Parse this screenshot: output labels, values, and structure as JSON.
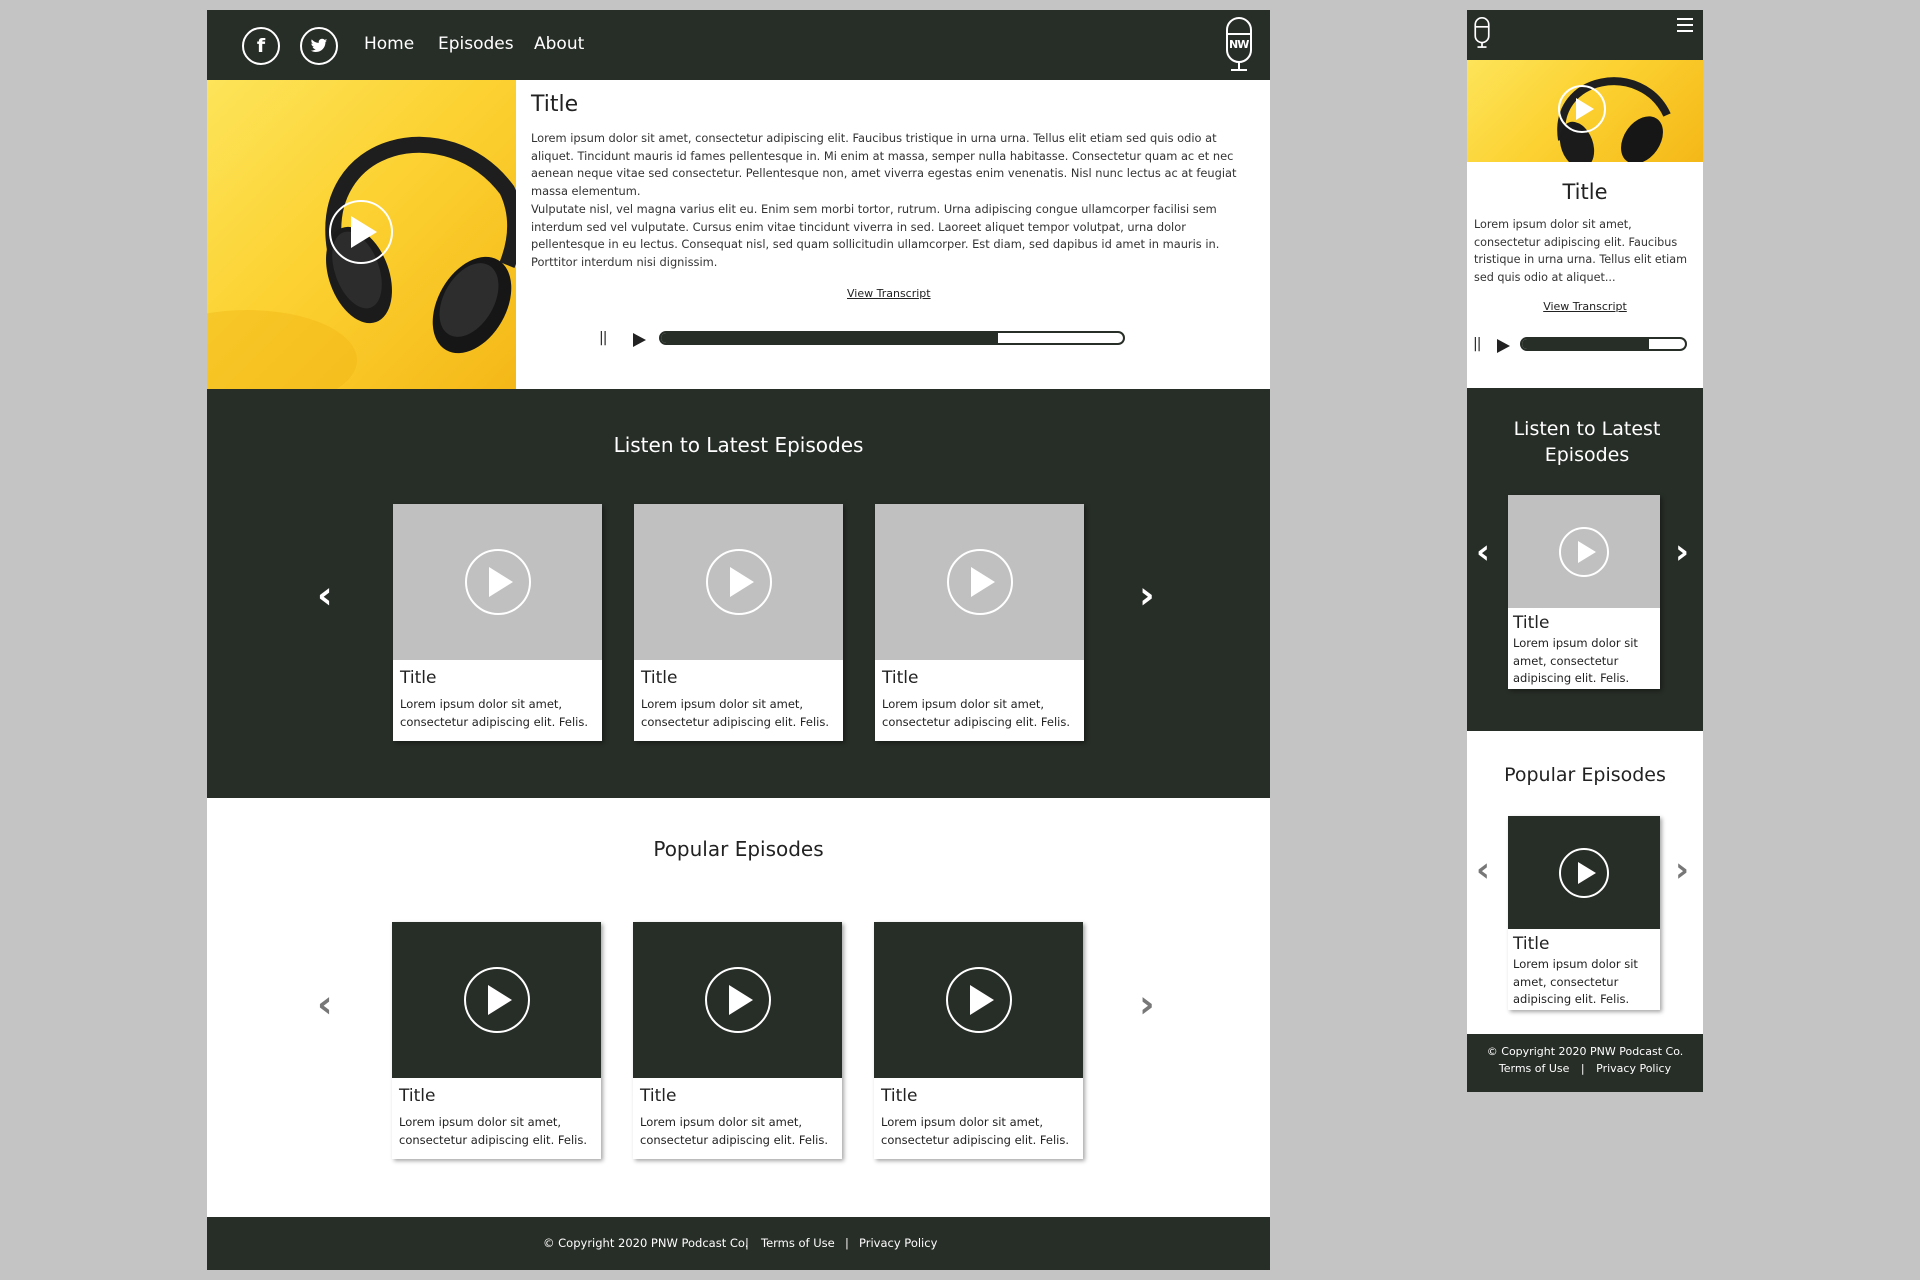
{
  "desktop": {
    "nav": {
      "social": [
        {
          "icon": "facebook-icon",
          "glyph": "f"
        },
        {
          "icon": "twitter-icon",
          "glyph": "t"
        }
      ],
      "links": [
        "Home",
        "Episodes",
        "About"
      ],
      "logo_text": "NW"
    },
    "hero": {
      "title": "Title",
      "paragraph1": "Lorem ipsum dolor sit amet, consectetur adipiscing elit. Faucibus tristique in urna urna. Tellus elit etiam sed quis odio at aliquet. Tincidunt mauris id fames pellentesque in. Mi enim at massa, semper nulla habitasse. Consectetur quam ac et nec aenean neque vitae sed consectetur. Pellentesque non, amet viverra egestas enim venenatis. Nisl nunc lectus ac at feugiat massa elementum.",
      "paragraph2": "Vulputate nisl, vel magna varius elit eu. Enim sem morbi tortor, rutrum. Urna adipiscing congue ullamcorper facilisi sem interdum sed vel vulputate. Cursus enim vitae tincidunt viverra in sed. Laoreet aliquet tempor volutpat, urna dolor pellentesque in eu lectus. Consequat nisl, sed quam sollicitudin ullamcorper. Est diam, sed dapibus id amet in mauris in. Porttitor interdum nisi dignissim.",
      "transcript_link": "View Transcript",
      "pause_glyph": "||",
      "progress": 0.73
    },
    "latest": {
      "heading": "Listen to Latest Episodes",
      "cards": [
        {
          "title": "Title",
          "text": "Lorem ipsum dolor sit amet, consectetur adipiscing elit. Felis."
        },
        {
          "title": "Title",
          "text": "Lorem ipsum dolor sit amet, consectetur adipiscing elit. Felis."
        },
        {
          "title": "Title",
          "text": "Lorem ipsum dolor sit amet, consectetur adipiscing elit. Felis."
        }
      ],
      "prev": "‹",
      "next": "›"
    },
    "popular": {
      "heading": "Popular Episodes",
      "cards": [
        {
          "title": "Title",
          "text": "Lorem ipsum dolor sit amet, consectetur adipiscing elit. Felis."
        },
        {
          "title": "Title",
          "text": "Lorem ipsum dolor sit amet, consectetur adipiscing elit. Felis."
        },
        {
          "title": "Title",
          "text": "Lorem ipsum dolor sit amet, consectetur adipiscing elit. Felis."
        }
      ],
      "prev": "‹",
      "next": "›"
    },
    "footer": {
      "copyright": "© Copyright 2020 PNW Podcast Co.",
      "sep": "|",
      "terms": "Terms of Use",
      "privacy": "Privacy Policy"
    }
  },
  "mobile": {
    "nav": {
      "logo_text": "NW",
      "menu_glyph": "≡"
    },
    "hero": {
      "title": "Title",
      "paragraph": "Lorem ipsum dolor sit amet, consectetur adipiscing elit. Faucibus tristique in urna urna. Tellus elit etiam sed quis odio at aliquet...",
      "transcript_link": "View Transcript",
      "pause_glyph": "||",
      "progress": 0.78
    },
    "latest": {
      "heading": "Listen to Latest Episodes",
      "card": {
        "title": "Title",
        "text": "Lorem ipsum dolor sit amet, consectetur adipiscing elit. Felis."
      },
      "prev": "‹",
      "next": "›"
    },
    "popular": {
      "heading": "Popular Episodes",
      "card": {
        "title": "Title",
        "text": "Lorem ipsum dolor sit amet, consectetur adipiscing elit. Felis."
      },
      "prev": "‹",
      "next": "›"
    },
    "footer": {
      "copyright": "© Copyright 2020 PNW Podcast Co.",
      "terms": "Terms of Use",
      "sep": "|",
      "privacy": "Privacy Policy"
    }
  },
  "colors": {
    "dark": "#272d27",
    "accent_yellow": "#fcd232",
    "page_bg": "#c4c4c4",
    "placeholder_gray": "#c0c0c0"
  }
}
